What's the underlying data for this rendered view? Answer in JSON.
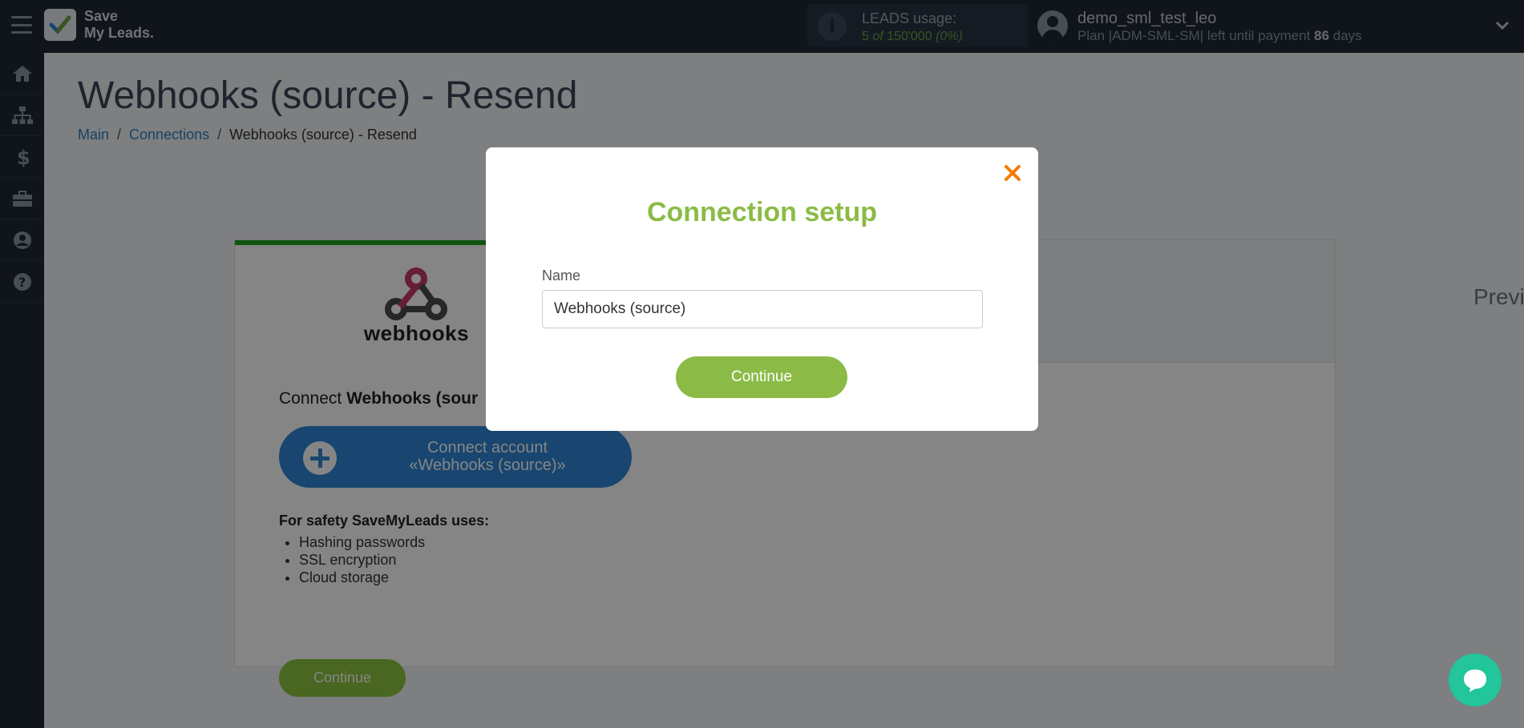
{
  "topbar": {
    "logo_line1": "Save",
    "logo_line2": "My Leads.",
    "leads_title": "LEADS usage:",
    "leads_used": "5",
    "leads_of": "of",
    "leads_total": "150'000",
    "leads_percent": "(0%)",
    "username": "demo_sml_test_leo",
    "plan_prefix": "Plan |ADM-SML-SM| left until payment",
    "plan_days": "86",
    "plan_suffix": "days"
  },
  "sidebar": {
    "items": [
      {
        "icon": "home-icon"
      },
      {
        "icon": "sitemap-icon"
      },
      {
        "icon": "dollar-icon"
      },
      {
        "icon": "briefcase-icon"
      },
      {
        "icon": "user-circle-icon"
      },
      {
        "icon": "help-icon"
      }
    ]
  },
  "page": {
    "title": "Webhooks (source) - Resend",
    "breadcrumb": {
      "main": "Main",
      "connections": "Connections",
      "current": "Webhooks (source) - Resend",
      "separator": "/"
    }
  },
  "card": {
    "source_name": "webhooks",
    "preview_tab": "Preview",
    "connect_prefix": "Connect",
    "connect_name": "Webhooks (sour",
    "connect_button_line1": "Connect account",
    "connect_button_line2": "«Webhooks (source)»",
    "safety_title": "For safety SaveMyLeads uses:",
    "safety_items": [
      "Hashing passwords",
      "SSL encryption",
      "Cloud storage"
    ],
    "continue_label": "Continue"
  },
  "modal": {
    "title": "Connection setup",
    "name_label": "Name",
    "name_value": "Webhooks (source)",
    "continue_label": "Continue"
  },
  "colors": {
    "accent_green": "#8bbb46",
    "close_orange": "#f57c00",
    "primary_blue": "#2f86d6",
    "chat_teal": "#23c59a",
    "topbar_dark": "#1f2937"
  }
}
